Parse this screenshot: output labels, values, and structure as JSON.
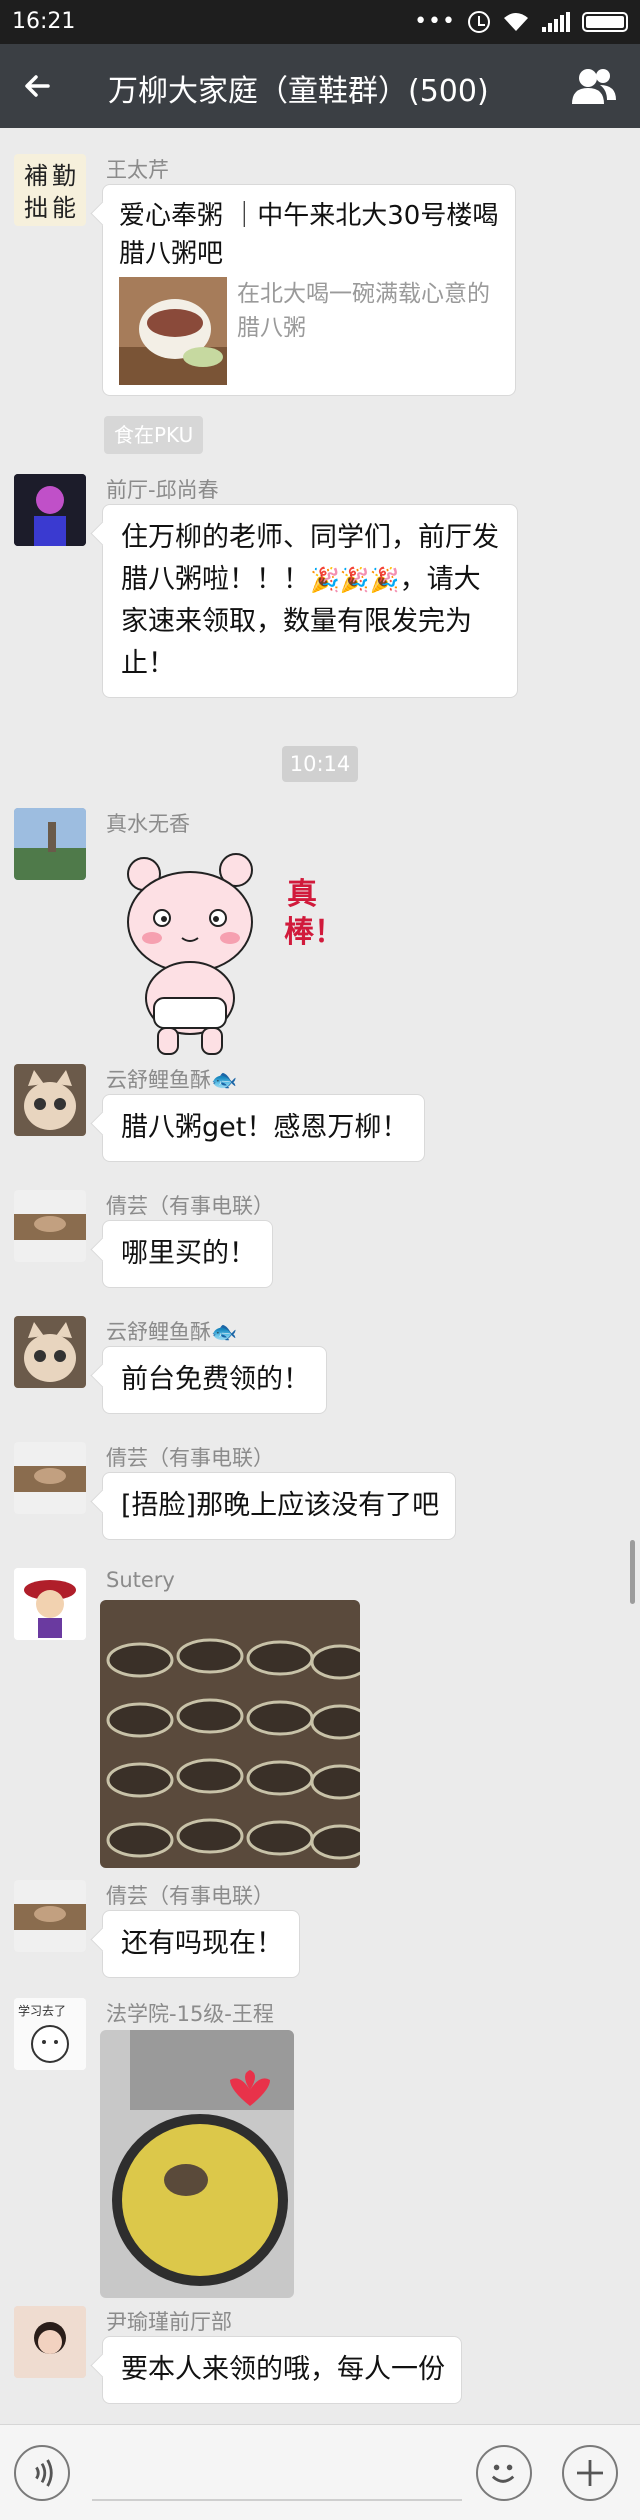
{
  "status_bar": {
    "time": "16:21",
    "icons": [
      "more-dots-icon",
      "alarm-icon",
      "wifi-icon",
      "signal-icon",
      "battery-icon"
    ]
  },
  "header": {
    "title": "万柳大家庭（童鞋群）(500)",
    "back_icon": "back-arrow-icon",
    "members_icon": "group-members-icon",
    "background": "#3b3f44"
  },
  "messages": [
    {
      "sender": "王太芹",
      "avatar": "calligraphy-avatar",
      "avatar_text": "補勤拙能",
      "card": {
        "title": "爱心奉粥 ｜中午来北大30号楼喝腊八粥吧",
        "description": "在北大喝一碗满载心意的腊八粥"
      },
      "source": "食在PKU"
    },
    {
      "sender": "前厅-邱尚春",
      "text_before": "住万柳的老师、同学们，前厅发腊八粥啦！！！",
      "emojis": "🎉🎉🎉",
      "text_after": "，请大家速来领取，数量有限发完为止！"
    },
    {
      "timestamp": "10:14"
    },
    {
      "sender": "真水无香",
      "sticker": "cartoon-bear-sticker",
      "sticker_text": "真棒！"
    },
    {
      "sender": "云舒鲤鱼酥🐟",
      "text": "腊八粥get！感恩万柳！"
    },
    {
      "sender": "倩芸（有事电联）",
      "text": "哪里买的！"
    },
    {
      "sender": "云舒鲤鱼酥🐟",
      "text": "前台免费领的！"
    },
    {
      "sender": "倩芸（有事电联）",
      "text": "[捂脸]那晚上应该没有了吧"
    },
    {
      "sender": "Sutery",
      "photo": "porridge-cups-photo"
    },
    {
      "sender": "倩芸（有事电联）",
      "text": "还有吗现在！"
    },
    {
      "sender": "法学院-15级-王程",
      "avatar_text": "学习去了",
      "photo": "porridge-lid-photo"
    },
    {
      "sender": "尹瑜瑾前厅部",
      "text": "要本人来领的哦，每人一份"
    }
  ],
  "input_bar": {
    "voice_icon": "voice-icon",
    "emoji_icon": "emoji-face-icon",
    "plus_icon": "plus-icon",
    "placeholder": ""
  },
  "colors": {
    "chat_background": "#ebebeb",
    "bubble": "#ffffff",
    "sender_name": "#8b8b8b",
    "status_bar": "#1e1e1e"
  }
}
